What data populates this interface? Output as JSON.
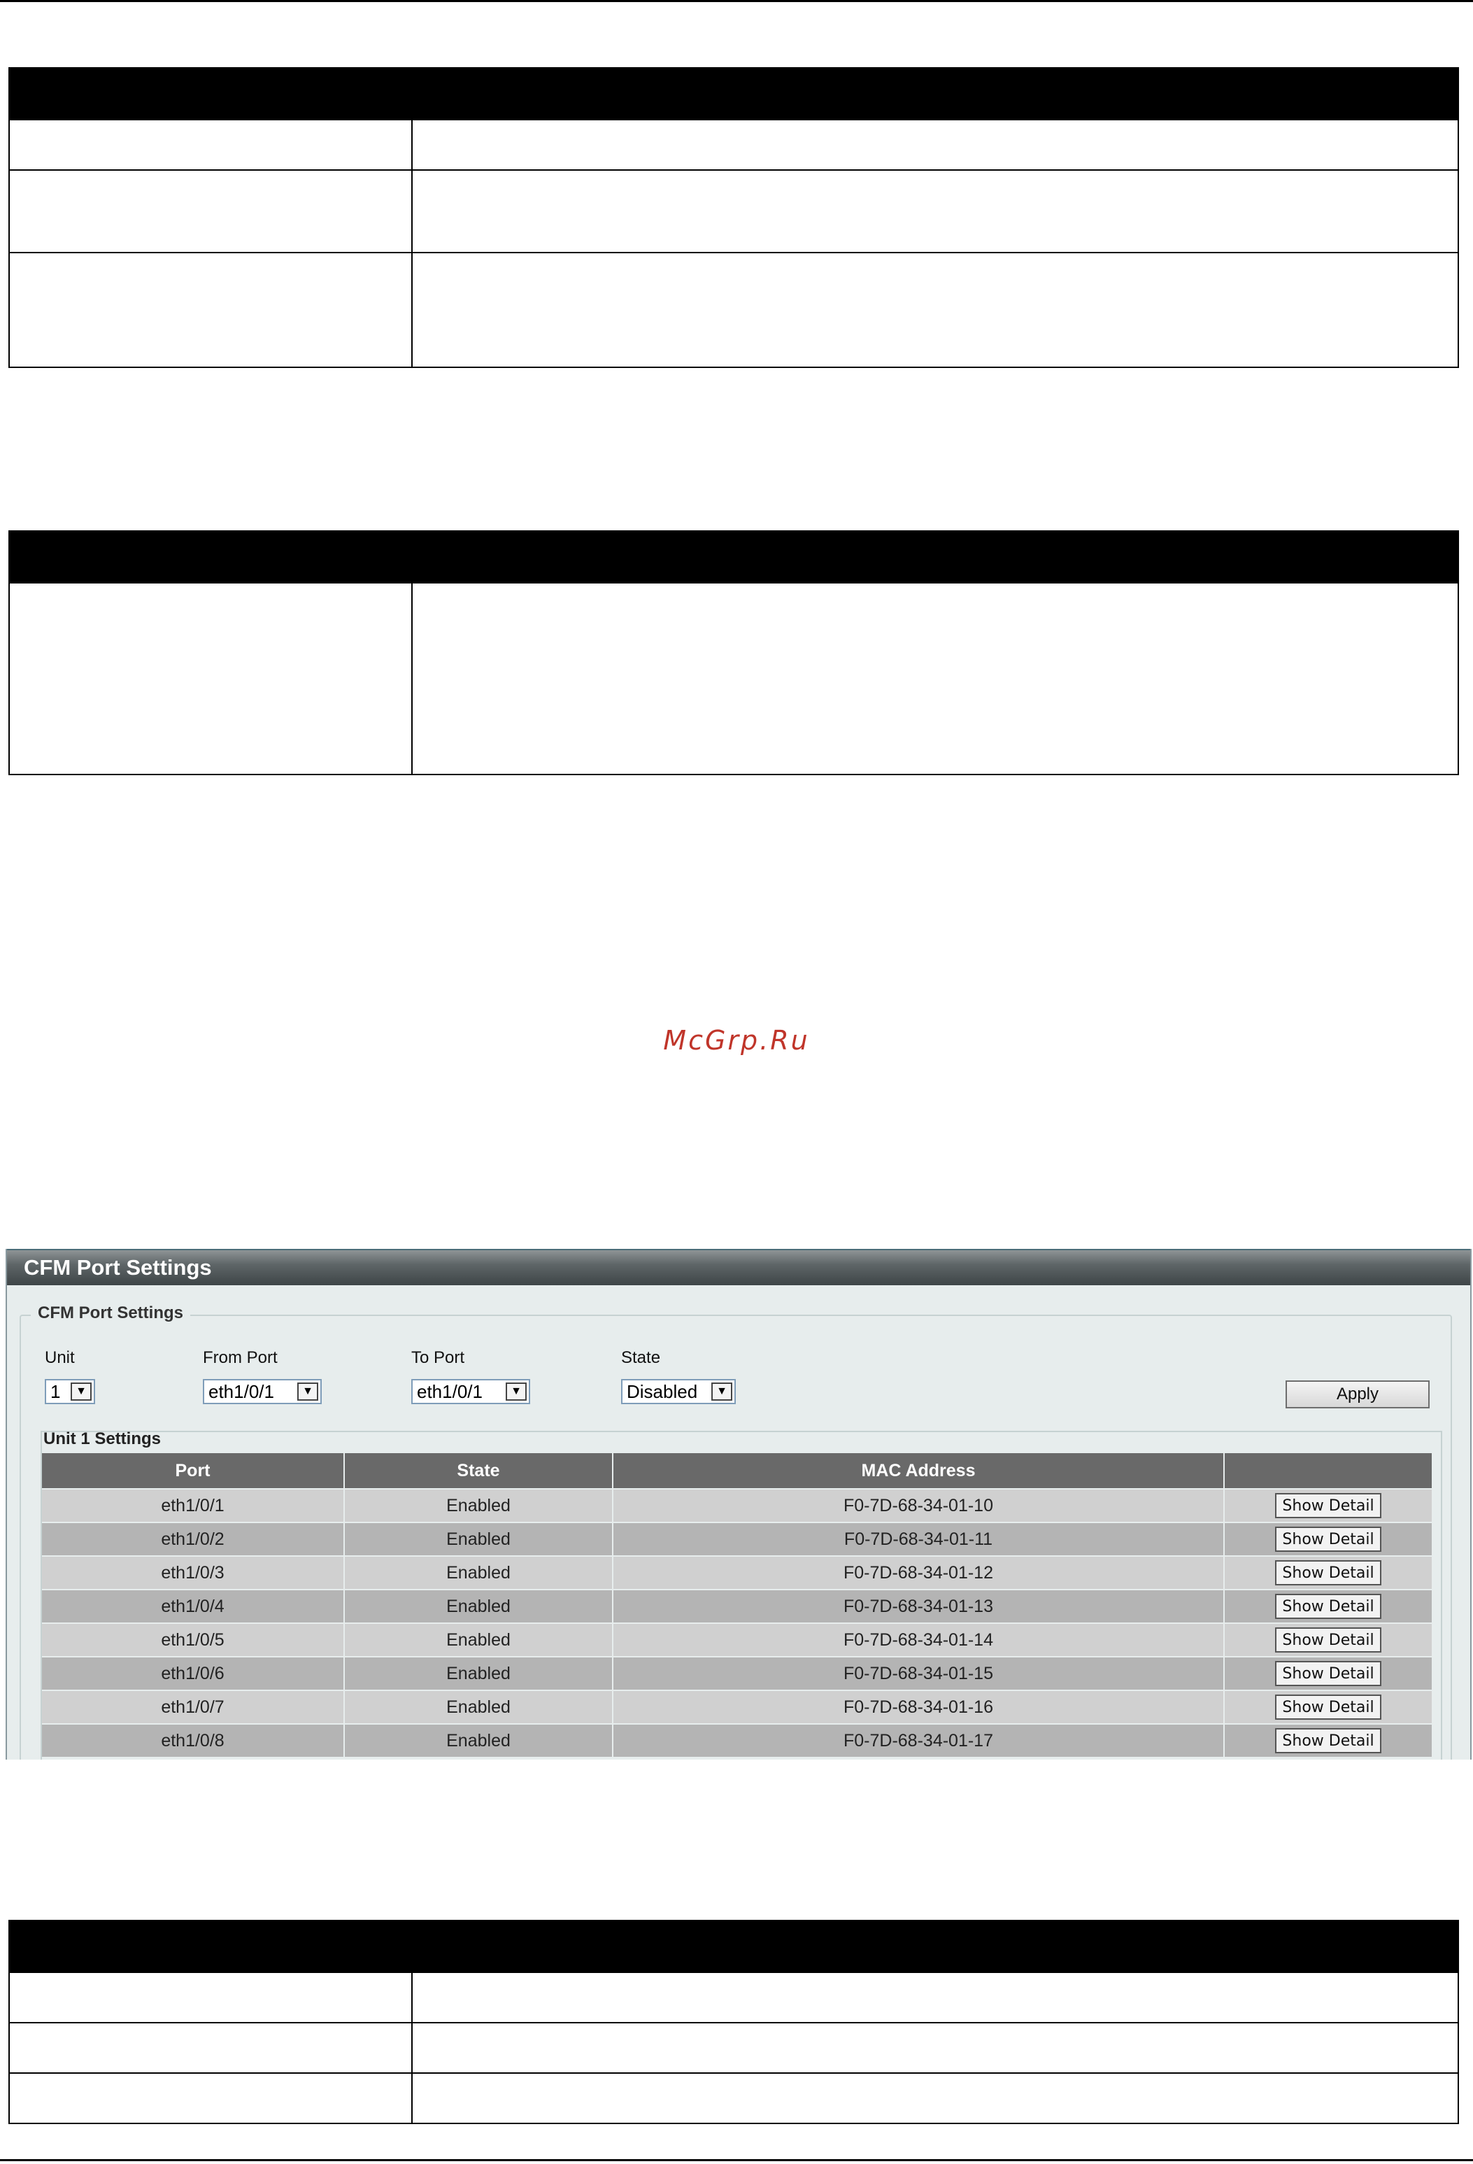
{
  "watermark": "McGrp.Ru",
  "screenshot": {
    "header_title": "CFM Port Settings",
    "fieldset_legend": "CFM Port Settings",
    "fields": {
      "unit": {
        "label": "Unit",
        "value": "1"
      },
      "from_port": {
        "label": "From Port",
        "value": "eth1/0/1"
      },
      "to_port": {
        "label": "To Port",
        "value": "eth1/0/1"
      },
      "state": {
        "label": "State",
        "value": "Disabled"
      }
    },
    "apply_label": "Apply",
    "unit_settings_title": "Unit 1 Settings",
    "table": {
      "columns": [
        "Port",
        "State",
        "MAC Address",
        ""
      ],
      "rows": [
        {
          "port": "eth1/0/1",
          "state": "Enabled",
          "mac": "F0-7D-68-34-01-10",
          "action": "Show Detail"
        },
        {
          "port": "eth1/0/2",
          "state": "Enabled",
          "mac": "F0-7D-68-34-01-11",
          "action": "Show Detail"
        },
        {
          "port": "eth1/0/3",
          "state": "Enabled",
          "mac": "F0-7D-68-34-01-12",
          "action": "Show Detail"
        },
        {
          "port": "eth1/0/4",
          "state": "Enabled",
          "mac": "F0-7D-68-34-01-13",
          "action": "Show Detail"
        },
        {
          "port": "eth1/0/5",
          "state": "Enabled",
          "mac": "F0-7D-68-34-01-14",
          "action": "Show Detail"
        },
        {
          "port": "eth1/0/6",
          "state": "Enabled",
          "mac": "F0-7D-68-34-01-15",
          "action": "Show Detail"
        },
        {
          "port": "eth1/0/7",
          "state": "Enabled",
          "mac": "F0-7D-68-34-01-16",
          "action": "Show Detail"
        },
        {
          "port": "eth1/0/8",
          "state": "Enabled",
          "mac": "F0-7D-68-34-01-17",
          "action": "Show Detail"
        }
      ]
    }
  }
}
